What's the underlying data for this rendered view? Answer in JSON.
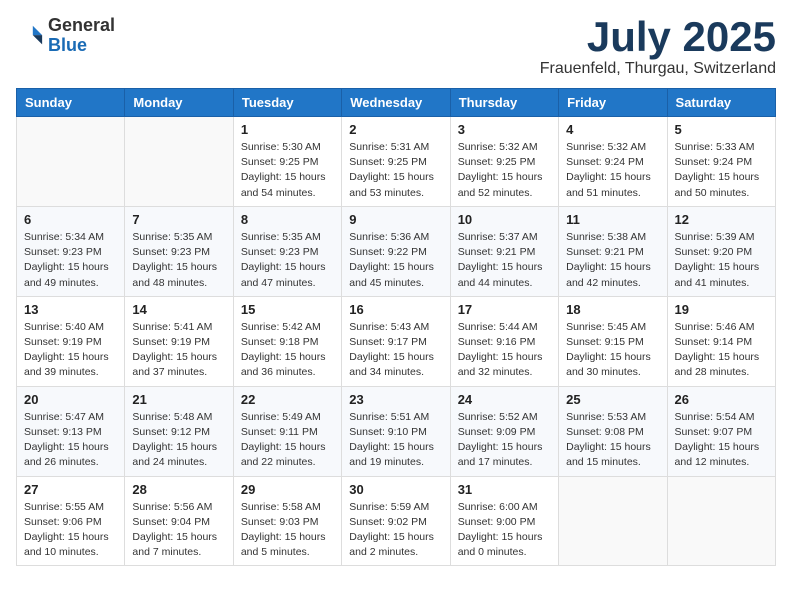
{
  "header": {
    "logo_general": "General",
    "logo_blue": "Blue",
    "month_title": "July 2025",
    "location": "Frauenfeld, Thurgau, Switzerland"
  },
  "weekdays": [
    "Sunday",
    "Monday",
    "Tuesday",
    "Wednesday",
    "Thursday",
    "Friday",
    "Saturday"
  ],
  "weeks": [
    [
      {
        "day": "",
        "sunrise": "",
        "sunset": "",
        "daylight": ""
      },
      {
        "day": "",
        "sunrise": "",
        "sunset": "",
        "daylight": ""
      },
      {
        "day": "1",
        "sunrise": "Sunrise: 5:30 AM",
        "sunset": "Sunset: 9:25 PM",
        "daylight": "Daylight: 15 hours and 54 minutes."
      },
      {
        "day": "2",
        "sunrise": "Sunrise: 5:31 AM",
        "sunset": "Sunset: 9:25 PM",
        "daylight": "Daylight: 15 hours and 53 minutes."
      },
      {
        "day": "3",
        "sunrise": "Sunrise: 5:32 AM",
        "sunset": "Sunset: 9:25 PM",
        "daylight": "Daylight: 15 hours and 52 minutes."
      },
      {
        "day": "4",
        "sunrise": "Sunrise: 5:32 AM",
        "sunset": "Sunset: 9:24 PM",
        "daylight": "Daylight: 15 hours and 51 minutes."
      },
      {
        "day": "5",
        "sunrise": "Sunrise: 5:33 AM",
        "sunset": "Sunset: 9:24 PM",
        "daylight": "Daylight: 15 hours and 50 minutes."
      }
    ],
    [
      {
        "day": "6",
        "sunrise": "Sunrise: 5:34 AM",
        "sunset": "Sunset: 9:23 PM",
        "daylight": "Daylight: 15 hours and 49 minutes."
      },
      {
        "day": "7",
        "sunrise": "Sunrise: 5:35 AM",
        "sunset": "Sunset: 9:23 PM",
        "daylight": "Daylight: 15 hours and 48 minutes."
      },
      {
        "day": "8",
        "sunrise": "Sunrise: 5:35 AM",
        "sunset": "Sunset: 9:23 PM",
        "daylight": "Daylight: 15 hours and 47 minutes."
      },
      {
        "day": "9",
        "sunrise": "Sunrise: 5:36 AM",
        "sunset": "Sunset: 9:22 PM",
        "daylight": "Daylight: 15 hours and 45 minutes."
      },
      {
        "day": "10",
        "sunrise": "Sunrise: 5:37 AM",
        "sunset": "Sunset: 9:21 PM",
        "daylight": "Daylight: 15 hours and 44 minutes."
      },
      {
        "day": "11",
        "sunrise": "Sunrise: 5:38 AM",
        "sunset": "Sunset: 9:21 PM",
        "daylight": "Daylight: 15 hours and 42 minutes."
      },
      {
        "day": "12",
        "sunrise": "Sunrise: 5:39 AM",
        "sunset": "Sunset: 9:20 PM",
        "daylight": "Daylight: 15 hours and 41 minutes."
      }
    ],
    [
      {
        "day": "13",
        "sunrise": "Sunrise: 5:40 AM",
        "sunset": "Sunset: 9:19 PM",
        "daylight": "Daylight: 15 hours and 39 minutes."
      },
      {
        "day": "14",
        "sunrise": "Sunrise: 5:41 AM",
        "sunset": "Sunset: 9:19 PM",
        "daylight": "Daylight: 15 hours and 37 minutes."
      },
      {
        "day": "15",
        "sunrise": "Sunrise: 5:42 AM",
        "sunset": "Sunset: 9:18 PM",
        "daylight": "Daylight: 15 hours and 36 minutes."
      },
      {
        "day": "16",
        "sunrise": "Sunrise: 5:43 AM",
        "sunset": "Sunset: 9:17 PM",
        "daylight": "Daylight: 15 hours and 34 minutes."
      },
      {
        "day": "17",
        "sunrise": "Sunrise: 5:44 AM",
        "sunset": "Sunset: 9:16 PM",
        "daylight": "Daylight: 15 hours and 32 minutes."
      },
      {
        "day": "18",
        "sunrise": "Sunrise: 5:45 AM",
        "sunset": "Sunset: 9:15 PM",
        "daylight": "Daylight: 15 hours and 30 minutes."
      },
      {
        "day": "19",
        "sunrise": "Sunrise: 5:46 AM",
        "sunset": "Sunset: 9:14 PM",
        "daylight": "Daylight: 15 hours and 28 minutes."
      }
    ],
    [
      {
        "day": "20",
        "sunrise": "Sunrise: 5:47 AM",
        "sunset": "Sunset: 9:13 PM",
        "daylight": "Daylight: 15 hours and 26 minutes."
      },
      {
        "day": "21",
        "sunrise": "Sunrise: 5:48 AM",
        "sunset": "Sunset: 9:12 PM",
        "daylight": "Daylight: 15 hours and 24 minutes."
      },
      {
        "day": "22",
        "sunrise": "Sunrise: 5:49 AM",
        "sunset": "Sunset: 9:11 PM",
        "daylight": "Daylight: 15 hours and 22 minutes."
      },
      {
        "day": "23",
        "sunrise": "Sunrise: 5:51 AM",
        "sunset": "Sunset: 9:10 PM",
        "daylight": "Daylight: 15 hours and 19 minutes."
      },
      {
        "day": "24",
        "sunrise": "Sunrise: 5:52 AM",
        "sunset": "Sunset: 9:09 PM",
        "daylight": "Daylight: 15 hours and 17 minutes."
      },
      {
        "day": "25",
        "sunrise": "Sunrise: 5:53 AM",
        "sunset": "Sunset: 9:08 PM",
        "daylight": "Daylight: 15 hours and 15 minutes."
      },
      {
        "day": "26",
        "sunrise": "Sunrise: 5:54 AM",
        "sunset": "Sunset: 9:07 PM",
        "daylight": "Daylight: 15 hours and 12 minutes."
      }
    ],
    [
      {
        "day": "27",
        "sunrise": "Sunrise: 5:55 AM",
        "sunset": "Sunset: 9:06 PM",
        "daylight": "Daylight: 15 hours and 10 minutes."
      },
      {
        "day": "28",
        "sunrise": "Sunrise: 5:56 AM",
        "sunset": "Sunset: 9:04 PM",
        "daylight": "Daylight: 15 hours and 7 minutes."
      },
      {
        "day": "29",
        "sunrise": "Sunrise: 5:58 AM",
        "sunset": "Sunset: 9:03 PM",
        "daylight": "Daylight: 15 hours and 5 minutes."
      },
      {
        "day": "30",
        "sunrise": "Sunrise: 5:59 AM",
        "sunset": "Sunset: 9:02 PM",
        "daylight": "Daylight: 15 hours and 2 minutes."
      },
      {
        "day": "31",
        "sunrise": "Sunrise: 6:00 AM",
        "sunset": "Sunset: 9:00 PM",
        "daylight": "Daylight: 15 hours and 0 minutes."
      },
      {
        "day": "",
        "sunrise": "",
        "sunset": "",
        "daylight": ""
      },
      {
        "day": "",
        "sunrise": "",
        "sunset": "",
        "daylight": ""
      }
    ]
  ]
}
